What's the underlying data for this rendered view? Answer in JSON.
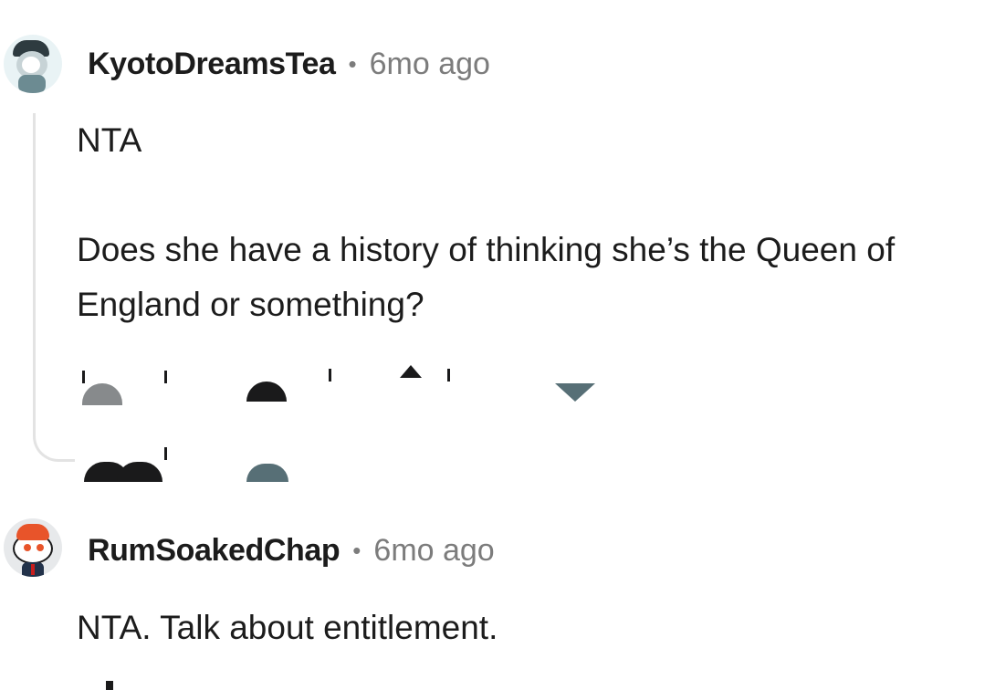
{
  "comments": [
    {
      "username": "KyotoDreamsTea",
      "separator": "•",
      "time": "6mo ago",
      "paragraphs": [
        "NTA",
        "Does she have a history of thinking she’s the Queen of England or something?"
      ],
      "avatar_icon": "snoo-avatar-icon"
    },
    {
      "username": "RumSoakedChap",
      "separator": "•",
      "time": "6mo ago",
      "paragraphs": [
        "NTA. Talk about entitlement."
      ],
      "avatar_icon": "snoo-avatar-icon"
    }
  ],
  "colors": {
    "text": "#1c1c1c",
    "meta": "#7c7c7c",
    "thread_line": "#e3e3e3",
    "icon_gray": "#878a8c",
    "icon_slate": "#576f76"
  }
}
